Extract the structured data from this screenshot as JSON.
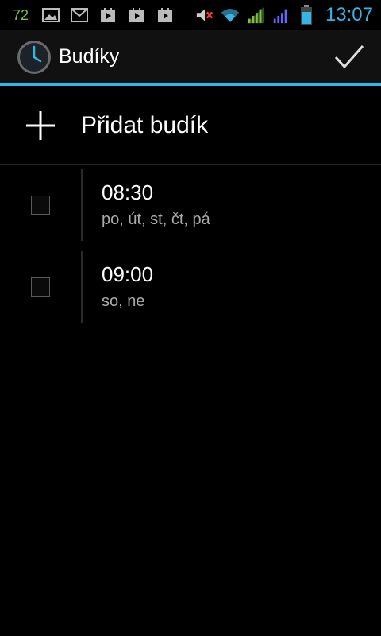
{
  "status_bar": {
    "notification_count": "72",
    "time": "13:07",
    "icons": [
      "image-icon",
      "gmail-icon",
      "play-store-icon",
      "play-store-icon",
      "play-store-icon",
      "mute-icon",
      "wifi-icon",
      "signal-icon",
      "signal-icon",
      "battery-icon"
    ],
    "colors": {
      "time": "#33b5e5",
      "count": "#7fbf3f",
      "signal_green": "#7fbf3f",
      "signal_blue": "#6666ff",
      "mute_x": "#ff3333"
    }
  },
  "action_bar": {
    "title": "Budíky",
    "app_icon": "clock-icon",
    "done_icon": "check-icon",
    "accent": "#33b5e5"
  },
  "add_alarm": {
    "label": "Přidat budík",
    "icon": "plus-icon"
  },
  "alarms": [
    {
      "time": "08:30",
      "days": "po, út, st, čt, pá",
      "enabled": false
    },
    {
      "time": "09:00",
      "days": "so, ne",
      "enabled": false
    }
  ]
}
